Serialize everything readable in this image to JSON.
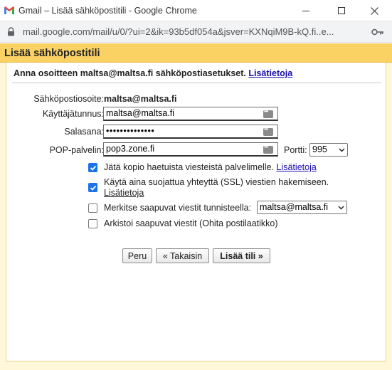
{
  "window": {
    "title": "Gmail – Lisää sähköpostitili - Google Chrome",
    "url": "mail.google.com/mail/u/0/?ui=2&ik=93b5df054a&jsver=KXNqiM9B-kQ.fi..e..."
  },
  "dialog": {
    "header": "Lisää sähköpostitili",
    "intro": "Anna osoitteen maltsa@maltsa.fi sähköpostiasetukset.",
    "intro_link": "Lisätietoja"
  },
  "form": {
    "email_label": "Sähköpostiosoite:",
    "email_value": "maltsa@maltsa.fi",
    "username_label": "Käyttäjätunnus:",
    "username_value": "maltsa@maltsa.fi",
    "password_label": "Salasana:",
    "password_value": "••••••••••••••",
    "pop_label": "POP-palvelin:",
    "pop_value": "pop3.zone.fi",
    "port_label": "Portti:",
    "port_value": "995"
  },
  "options": [
    {
      "text": "Jätä kopio haetuista viesteistä palvelimelle.",
      "link": "Lisätietoja",
      "checked": true
    },
    {
      "text": "Käytä aina suojattua yhteyttä (SSL) viestien hakemiseen.",
      "link": "Lisätietoja",
      "checked": true
    },
    {
      "text": "Merkitse saapuvat viestit tunnisteella:",
      "select": "maltsa@maltsa.fi",
      "checked": false
    },
    {
      "text": "Arkistoi saapuvat viestit (Ohita postilaatikko)",
      "checked": false
    }
  ],
  "buttons": {
    "cancel": "Peru",
    "back": "« Takaisin",
    "add": "Lisää tili »"
  },
  "colors": {
    "header_band": "#fad163",
    "panel_bg": "#fff7d7",
    "link": "#1a0dab",
    "checkbox_checked": "#1a73e8"
  }
}
